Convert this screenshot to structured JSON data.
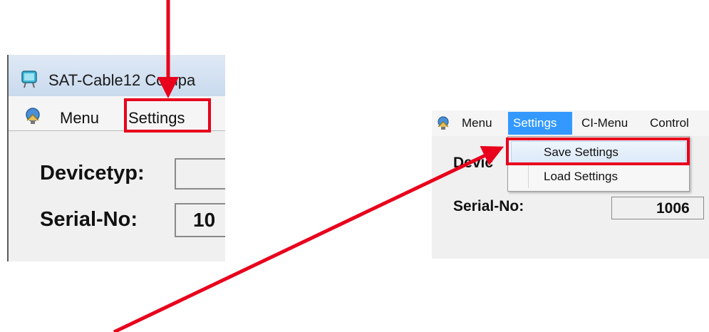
{
  "left_window": {
    "title": "SAT-Cable12 Compa",
    "menu": [
      "Menu",
      "Settings"
    ],
    "labels": {
      "devicetyp": "Devicetyp:",
      "serial": "Serial-No:",
      "serial_value": "10"
    }
  },
  "right_window": {
    "menu": [
      "Menu",
      "Settings",
      "CI-Menu",
      "Control"
    ],
    "dropdown": [
      "Save Settings",
      "Load Settings"
    ],
    "labels": {
      "device_partial": "Devic",
      "serial": "Serial-No:",
      "serial_value": "1006"
    }
  },
  "colors": {
    "annotation": "#e8001c",
    "menu_highlight": "#3399ff"
  }
}
